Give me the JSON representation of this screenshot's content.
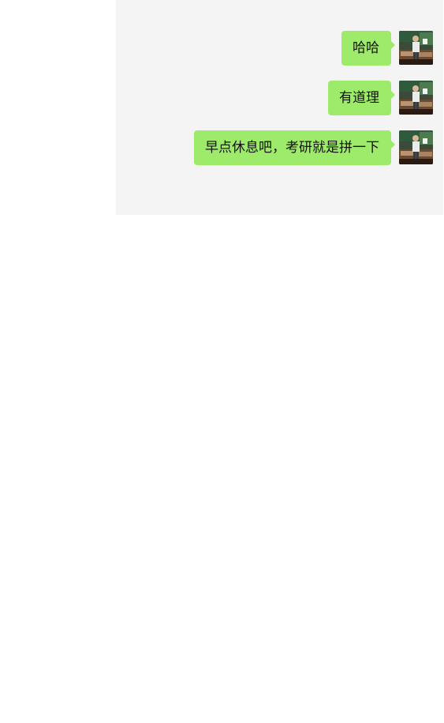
{
  "chat": {
    "messages": [
      {
        "text": "哈哈",
        "sender": "self",
        "avatar_icon": "user-avatar-icon"
      },
      {
        "text": "有道理",
        "sender": "self",
        "avatar_icon": "user-avatar-icon"
      },
      {
        "text": "早点休息吧，考研就是拼一下",
        "sender": "self",
        "avatar_icon": "user-avatar-icon"
      }
    ]
  },
  "colors": {
    "chat_background": "#f4f4f4",
    "bubble_self": "#9eea6a",
    "page_background": "#ffffff"
  }
}
